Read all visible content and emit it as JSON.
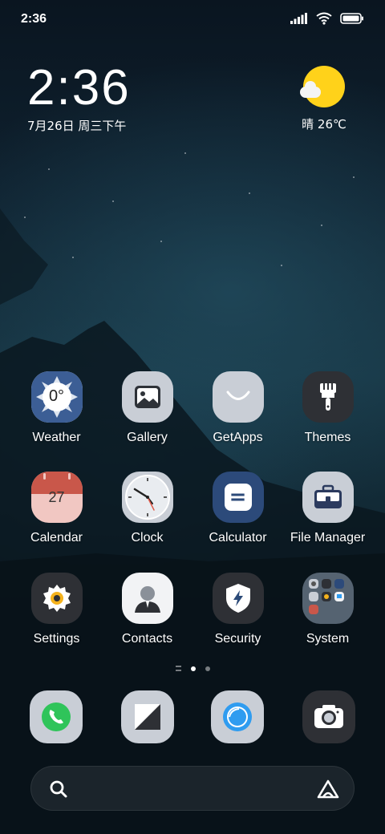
{
  "status_bar": {
    "time": "2:36",
    "icons": [
      "signal-icon",
      "wifi-icon",
      "battery-icon"
    ]
  },
  "clock_widget": {
    "time": "2:36",
    "date": "7月26日 周三下午"
  },
  "weather_widget": {
    "condition_temp": "晴 26℃",
    "icon": "sun-cloud-icon"
  },
  "apps": [
    {
      "label": "Weather",
      "icon": "weather-icon",
      "icon_text": "0°"
    },
    {
      "label": "Gallery",
      "icon": "gallery-icon"
    },
    {
      "label": "GetApps",
      "icon": "getapps-icon"
    },
    {
      "label": "Themes",
      "icon": "themes-brush-icon"
    },
    {
      "label": "Calendar",
      "icon": "calendar-icon",
      "icon_text": "27"
    },
    {
      "label": "Clock",
      "icon": "clock-icon"
    },
    {
      "label": "Calculator",
      "icon": "calculator-icon",
      "icon_text": "="
    },
    {
      "label": "File Manager",
      "icon": "file-manager-icon"
    },
    {
      "label": "Settings",
      "icon": "settings-gear-icon"
    },
    {
      "label": "Contacts",
      "icon": "contacts-icon"
    },
    {
      "label": "Security",
      "icon": "security-shield-icon"
    },
    {
      "label": "System",
      "icon": "system-folder-icon"
    }
  ],
  "page_indicator": {
    "pages": 2,
    "active": 1
  },
  "dock": [
    {
      "name": "phone",
      "icon": "phone-icon"
    },
    {
      "name": "messages",
      "icon": "messages-icon"
    },
    {
      "name": "browser",
      "icon": "browser-icon"
    },
    {
      "name": "camera",
      "icon": "camera-icon"
    }
  ],
  "search_bar": {
    "left_icon": "search-icon",
    "right_icon": "assistant-icon"
  },
  "colors": {
    "sun": "#ffd21a",
    "calendar_top": "#c9574a",
    "calendar_bottom": "#f1c7c2",
    "calculator": "#2c4a7a",
    "phone_green": "#2fc45a",
    "browser_blue": "#2f9cf0"
  }
}
